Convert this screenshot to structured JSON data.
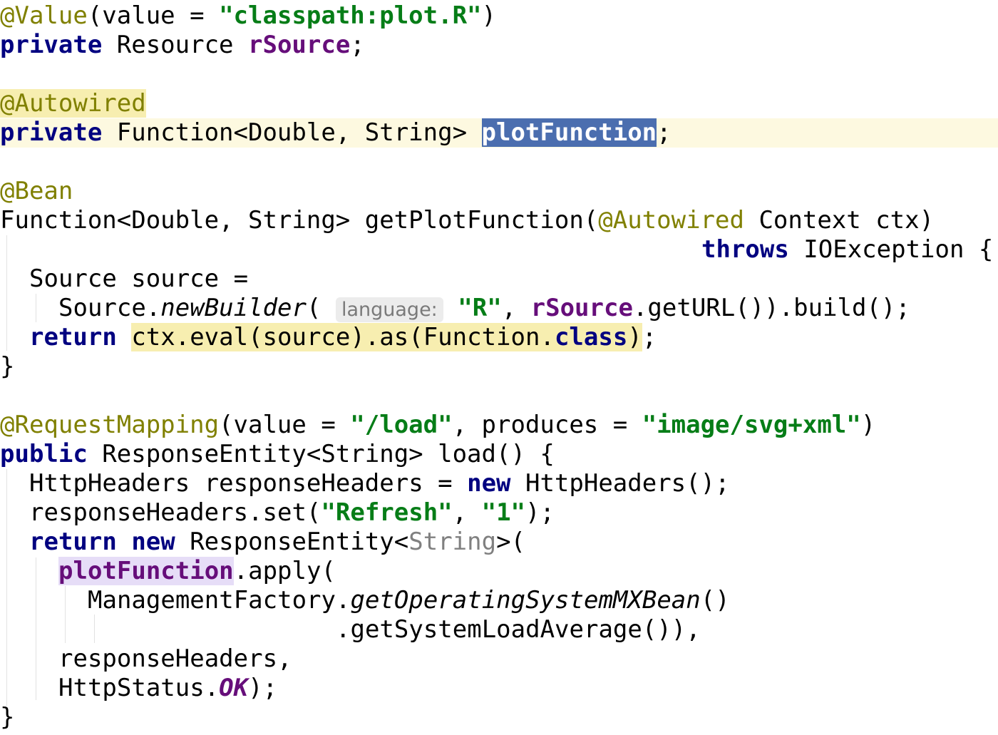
{
  "code": {
    "l1": {
      "ann": "@Value",
      "open": "(value = ",
      "str": "\"classpath:plot.R\"",
      "close": ")"
    },
    "l2": {
      "kw": "private",
      "type": " Resource ",
      "field": "rSource",
      "end": ";"
    },
    "l4": {
      "ann": "@Autowired"
    },
    "l5": {
      "kw": "private",
      "type": " Function<Double, String> ",
      "field": "plotFunction",
      "end": ";"
    },
    "l7": {
      "ann": "@Bean"
    },
    "l8": {
      "text": "Function<Double, String> getPlotFunction(",
      "ann": "@Autowired",
      "end": " Context ctx)"
    },
    "l9": {
      "kw": "throws",
      "end": " IOException {"
    },
    "l10": {
      "text": "Source source ="
    },
    "l11": {
      "pre": "Source.",
      "method": "newBuilder",
      "paren": "(",
      "hint": "language:",
      "str": "\"R\"",
      "comma": ", ",
      "field": "rSource",
      "end": ".getURL()).build();"
    },
    "l12": {
      "kw": "return",
      "expr_a": "ctx.eval(source).as(Function.",
      "kw2": "class",
      "expr_b": ")",
      "end": ";"
    },
    "l13": {
      "text": "}"
    },
    "l15": {
      "ann": "@RequestMapping",
      "a": "(value = ",
      "str1": "\"/load\"",
      "b": ", produces = ",
      "str2": "\"image/svg+xml\"",
      "c": ")"
    },
    "l16": {
      "kw": "public",
      "end": " ResponseEntity<String> load() {"
    },
    "l17": {
      "pre": "HttpHeaders responseHeaders = ",
      "kw": "new",
      "end": " HttpHeaders();"
    },
    "l18": {
      "pre": "responseHeaders.set(",
      "str1": "\"Refresh\"",
      "comma": ", ",
      "str2": "\"1\"",
      "end": ");"
    },
    "l19": {
      "kw1": "return",
      "kw2": "new",
      "a": " ResponseEntity<",
      "gray": "String",
      "b": ">("
    },
    "l20": {
      "field": "plotFunction",
      "end": ".apply("
    },
    "l21": {
      "pre": "ManagementFactory.",
      "method": "getOperatingSystemMXBean",
      "end": "()"
    },
    "l22": {
      "text": ".getSystemLoadAverage()),"
    },
    "l23": {
      "text": "responseHeaders,"
    },
    "l24": {
      "pre": "HttpStatus.",
      "const": "OK",
      "end": ");"
    },
    "l25": {
      "text": "}"
    }
  }
}
